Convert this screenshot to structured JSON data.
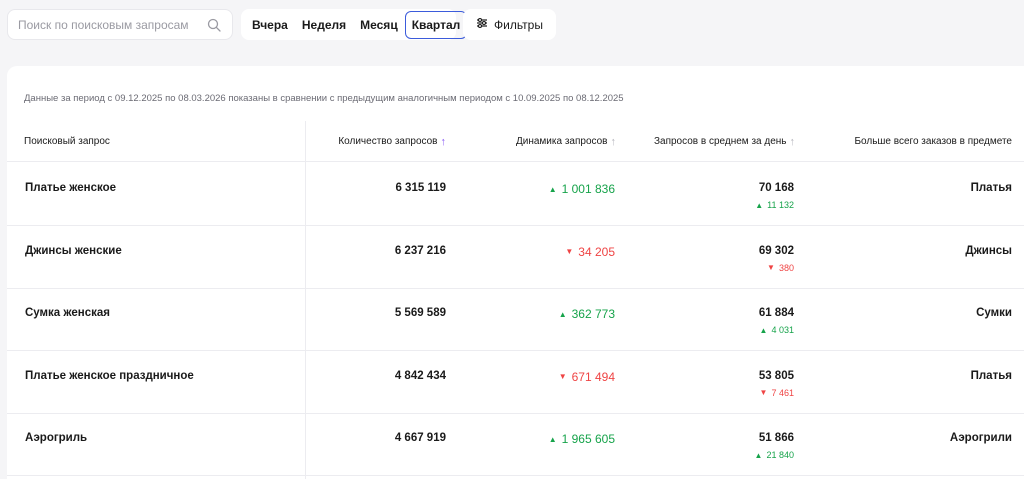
{
  "search": {
    "placeholder": "Поиск по поисковым запросам"
  },
  "periods": [
    "Вчера",
    "Неделя",
    "Месяц",
    "Квартал"
  ],
  "active_period": "Квартал",
  "filters_label": "Фильтры",
  "period_note": "Данные за период с 09.12.2025 по 08.03.2026 показаны в сравнении с предыдущим аналогичным периодом с 10.09.2025 по 08.12.2025",
  "columns": {
    "query": "Поисковый запрос",
    "count": "Количество запросов",
    "dynamics": "Динамика запросов",
    "avg": "Запросов в среднем за день",
    "subject": "Больше всего заказов в предмете"
  },
  "sort_arrow": "↑",
  "rows": [
    {
      "query": "Платье женское",
      "count": "6 315 119",
      "dyn": "1 001 836",
      "dyn_dir": "up",
      "avg": "70 168",
      "avg_delta": "11 132",
      "avg_dir": "up",
      "subject": "Платья"
    },
    {
      "query": "Джинсы женские",
      "count": "6 237 216",
      "dyn": "34 205",
      "dyn_dir": "down",
      "avg": "69 302",
      "avg_delta": "380",
      "avg_dir": "down",
      "subject": "Джинсы"
    },
    {
      "query": "Сумка женская",
      "count": "5 569 589",
      "dyn": "362 773",
      "dyn_dir": "up",
      "avg": "61 884",
      "avg_delta": "4 031",
      "avg_dir": "up",
      "subject": "Сумки"
    },
    {
      "query": "Платье женское праздничное",
      "count": "4 842 434",
      "dyn": "671 494",
      "dyn_dir": "down",
      "avg": "53 805",
      "avg_delta": "7 461",
      "avg_dir": "down",
      "subject": "Платья"
    },
    {
      "query": "Аэрогриль",
      "count": "4 667 919",
      "dyn": "1 965 605",
      "dyn_dir": "up",
      "avg": "51 866",
      "avg_delta": "21 840",
      "avg_dir": "up",
      "subject": "Аэрогрили"
    }
  ],
  "colors": {
    "up": "#16a34a",
    "down": "#ef4444",
    "active_border": "#3b5bdb",
    "sort_active": "#8b5cf6"
  }
}
